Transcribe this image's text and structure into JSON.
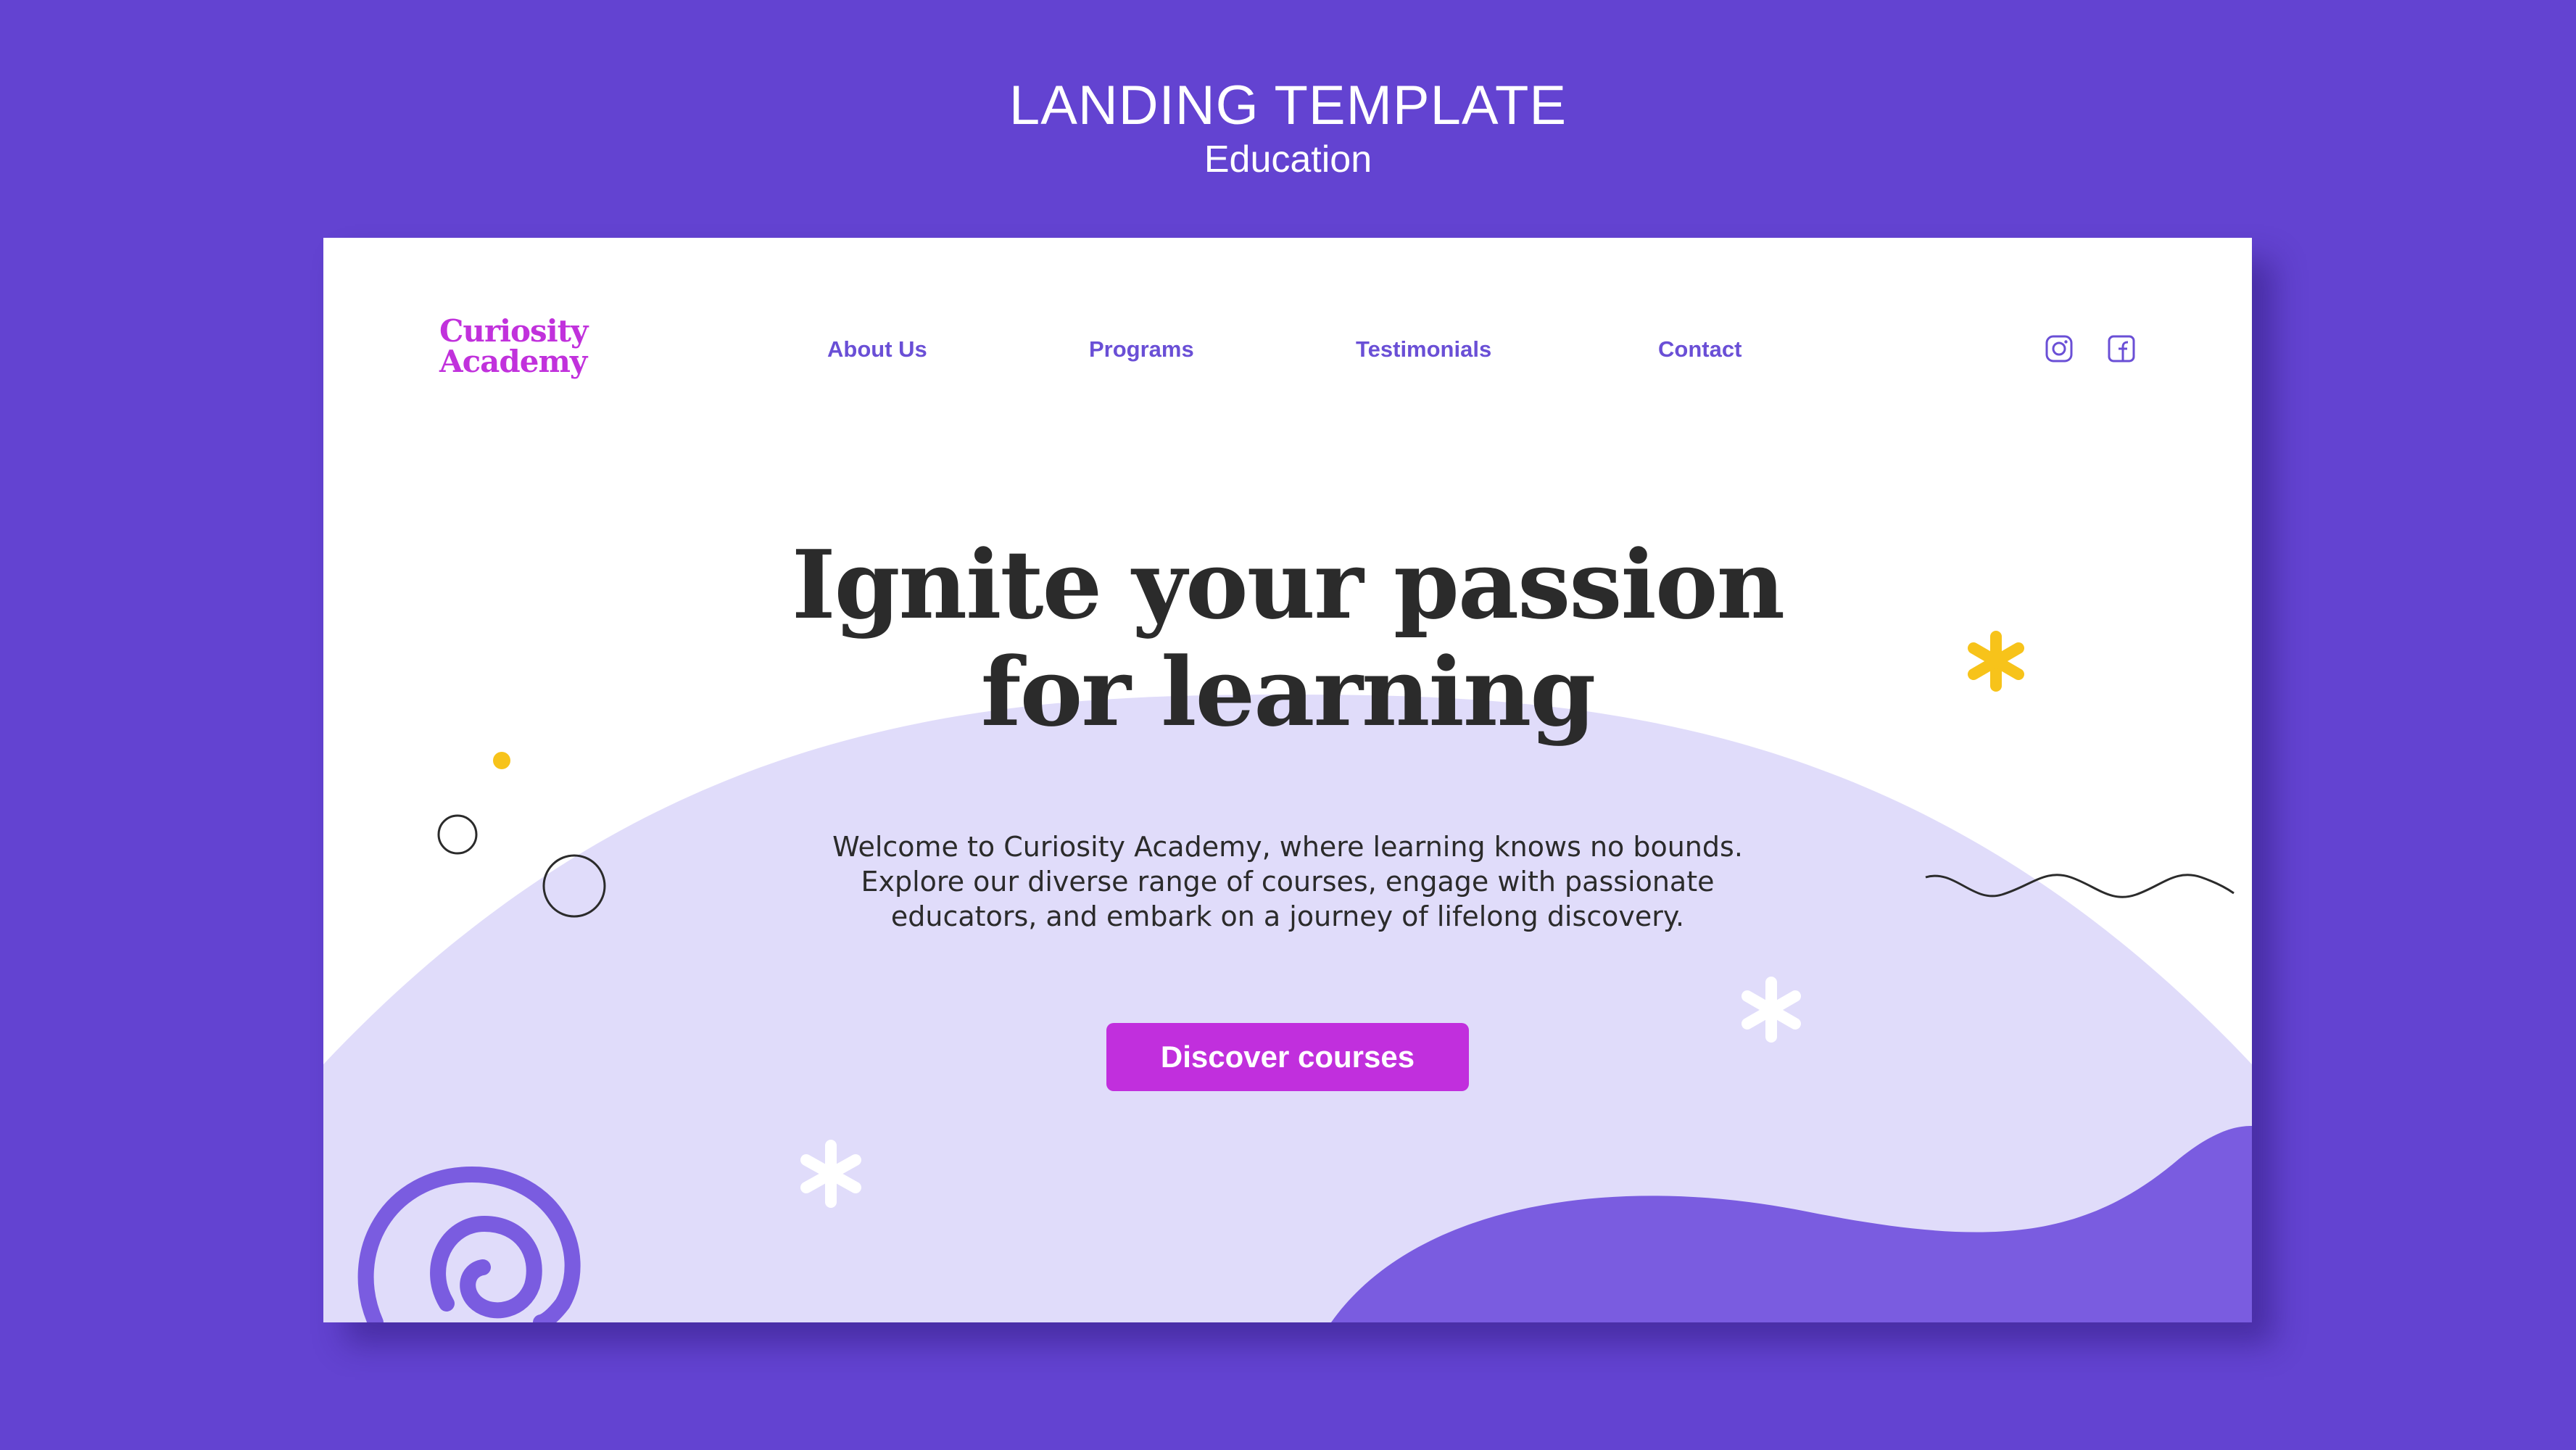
{
  "header": {
    "title": "LANDING TEMPLATE",
    "subtitle": "Education"
  },
  "brand": {
    "line1": "Curiosity",
    "line2": "Academy"
  },
  "nav": {
    "items": [
      {
        "label": "About Us"
      },
      {
        "label": "Programs"
      },
      {
        "label": "Testimonials"
      },
      {
        "label": "Contact"
      }
    ]
  },
  "social": {
    "icons": [
      "instagram-icon",
      "facebook-icon"
    ]
  },
  "hero": {
    "headline_line1": "Ignite your passion",
    "headline_line2": "for learning",
    "intro_line1": "Welcome to Curiosity Academy, where learning knows no bounds.",
    "intro_line2": "Explore our diverse range of courses, engage with passionate",
    "intro_line3": "educators, and embark on a journey of lifelong discovery.",
    "cta_label": "Discover courses"
  },
  "colors": {
    "page_background": "#6343d1",
    "card_background": "#ffffff",
    "brand": "#c131dc",
    "nav_text": "#6a4fd6",
    "cta": "#c12fdd",
    "light_blob": "#e0dcfa",
    "wave": "#7a5ce0",
    "accent_yellow": "#f7c31a",
    "heading_text": "#2b2b2b"
  }
}
